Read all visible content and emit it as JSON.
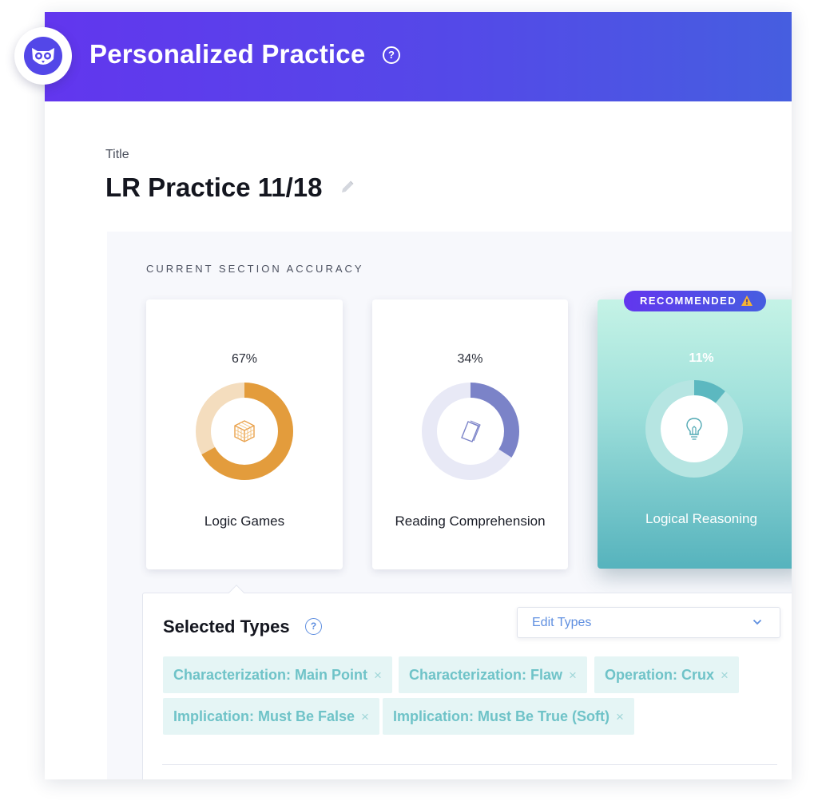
{
  "header": {
    "title": "Personalized Practice",
    "help_glyph": "?"
  },
  "logo": {
    "icon": "owl-logo-icon"
  },
  "practice": {
    "title_label": "Title",
    "title": "LR Practice 11/18",
    "edit_icon": "pencil-icon"
  },
  "accuracy": {
    "section_label": "CURRENT SECTION ACCURACY",
    "recommended_label": "RECOMMENDED",
    "cards": [
      {
        "name": "Logic Games",
        "percent_label": "67%",
        "value": 0.67,
        "icon": "cube-icon",
        "color": "#e39c3c",
        "track": "#f4ddbe"
      },
      {
        "name": "Reading Comprehension",
        "percent_label": "34%",
        "value": 0.34,
        "icon": "book-icon",
        "color": "#7b83c8",
        "track": "#e8e9f6"
      },
      {
        "name": "Logical Reasoning",
        "percent_label": "11%",
        "value": 0.11,
        "icon": "lightbulb-icon",
        "color": "#5cb8c0",
        "track": "#b6e5e2",
        "recommended": true
      }
    ]
  },
  "types": {
    "title": "Selected Types",
    "help_glyph": "?",
    "dropdown_label": "Edit Types",
    "remove_glyph": "×",
    "chips": [
      "Characterization: Main Point",
      "Characterization: Flaw",
      "Operation: Crux",
      "Implication: Must Be False",
      "Implication: Must Be True (Soft)"
    ]
  },
  "colors": {
    "header_start": "#6236ee",
    "header_end": "#465ee0",
    "accent": "#5f8fe0",
    "chip_text": "#6fc3c8",
    "chip_bg": "#e5f5f5"
  }
}
